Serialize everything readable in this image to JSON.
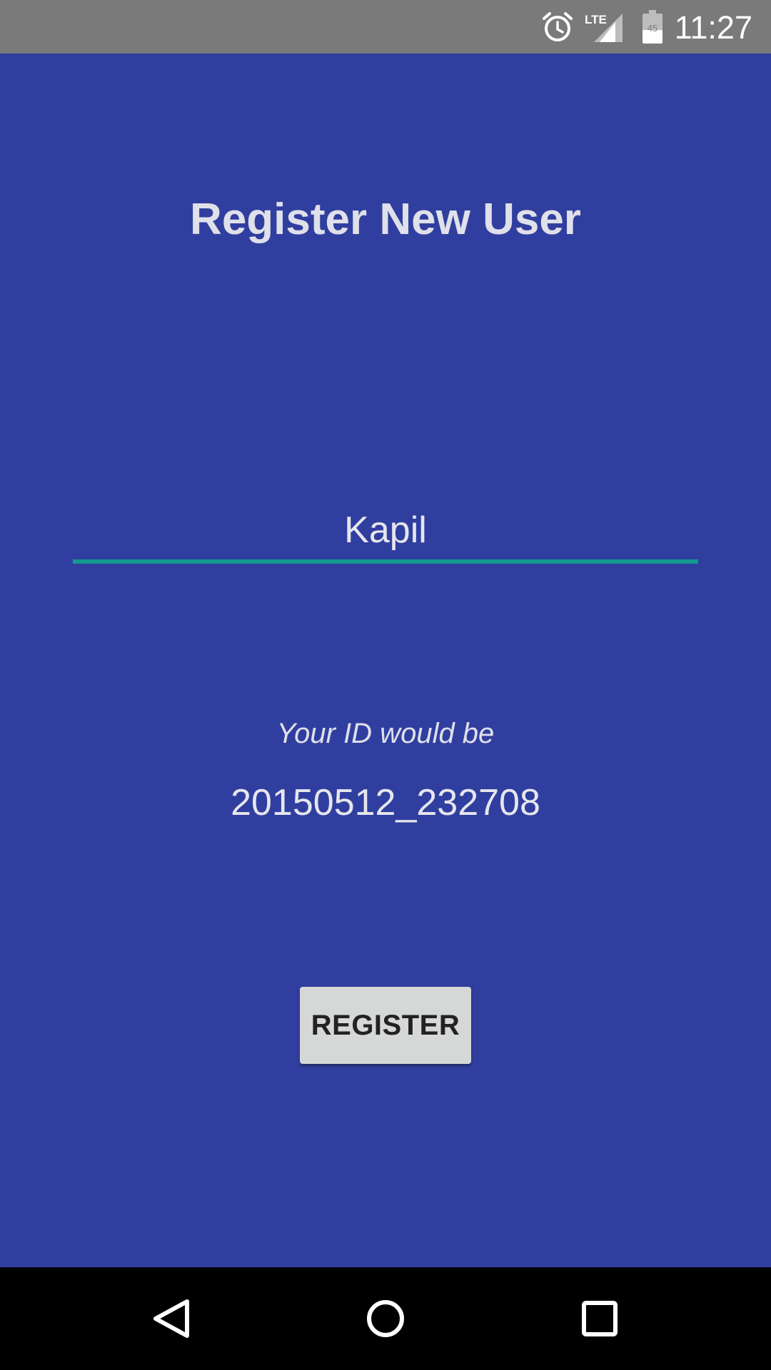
{
  "status_bar": {
    "time": "11:27",
    "battery_level": "45",
    "network": "LTE",
    "icons": [
      "alarm-icon",
      "lte-signal-icon",
      "battery-icon"
    ]
  },
  "screen": {
    "title": "Register New User",
    "name_input": {
      "value": "Kapil"
    },
    "id_caption": "Your ID would be",
    "id_value": "20150512_232708",
    "register_label": "REGISTER"
  },
  "nav_bar": {
    "icons": [
      "back-icon",
      "home-icon",
      "recents-icon"
    ]
  },
  "colors": {
    "background": "#303F9F",
    "status_bar": "#7A7A7A",
    "accent_underline": "#139A8E",
    "button": "#D6D7D7",
    "nav_bar": "#000000"
  }
}
